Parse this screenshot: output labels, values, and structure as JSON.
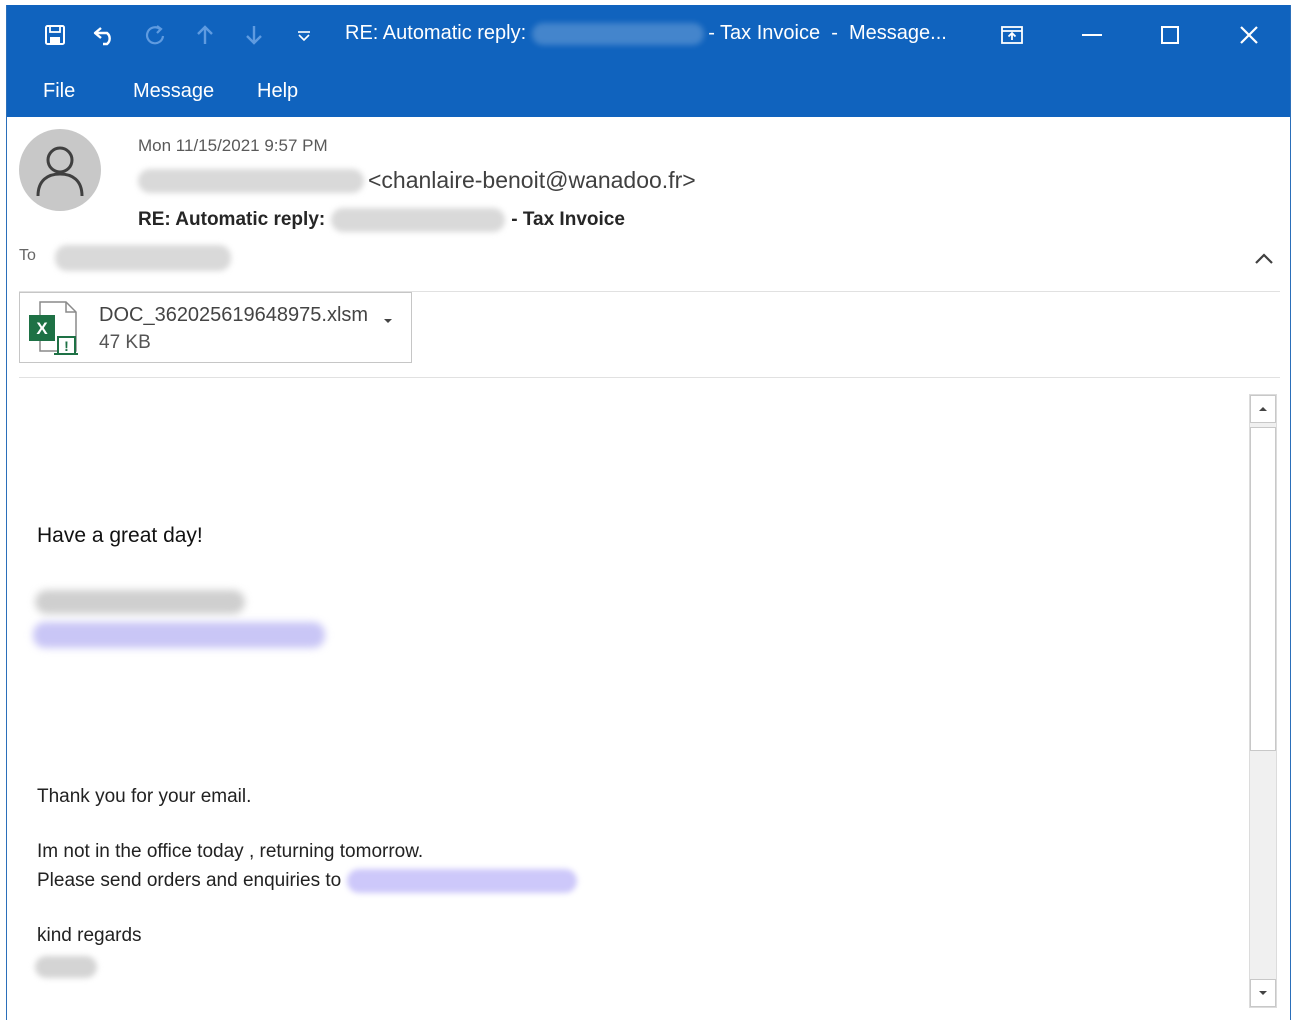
{
  "titlebar": {
    "title_prefix": "RE: Automatic reply:",
    "title_suffix": "- Tax Invoice  -  Message...",
    "icons": [
      "save-icon",
      "undo-icon",
      "redo-icon",
      "previous-item-icon",
      "next-item-icon",
      "customize-quick-access-icon",
      "ribbon-display-options-icon",
      "minimize-icon",
      "maximize-icon",
      "close-icon"
    ]
  },
  "menu": {
    "items": [
      "File",
      "Message",
      "Help"
    ]
  },
  "header": {
    "date": "Mon 11/15/2021 9:57 PM",
    "sender_email": "<chanlaire-benoit@wanadoo.fr>",
    "subject_prefix": "RE: Automatic reply:",
    "subject_suffix": "- Tax Invoice",
    "to_label": "To"
  },
  "attachment": {
    "filename": "DOC_362025619648975.xlsm",
    "size": "47 KB",
    "icon": "excel-macro-file-icon"
  },
  "body": {
    "greeting": "Have a great day!",
    "line1": "Thank you for your email.",
    "line2": "Im not in the office today , returning tomorrow.",
    "line3": "Please send orders and enquiries to",
    "line4": "kind regards"
  },
  "colors": {
    "titlebar": "#1063be",
    "avatar": "#c8c8c8",
    "excel_green": "#1e7145"
  }
}
